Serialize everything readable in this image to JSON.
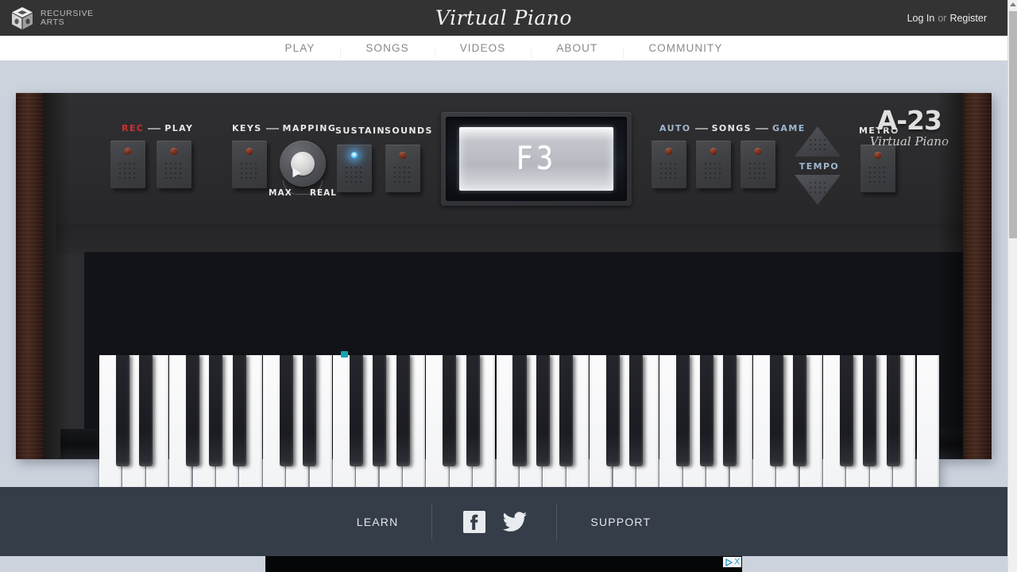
{
  "header": {
    "logo_icon": "cube-logo-icon",
    "brand_line1": "RECURSIVE",
    "brand_line2": "ARTS",
    "site_title": "Virtual Piano",
    "login_label": "Log In",
    "or_label": "or",
    "register_label": "Register"
  },
  "nav": {
    "items": [
      {
        "label": "PLAY"
      },
      {
        "label": "SONGS"
      },
      {
        "label": "VIDEOS"
      },
      {
        "label": "ABOUT"
      },
      {
        "label": "COMMUNITY"
      }
    ]
  },
  "piano": {
    "model_name": "A-23",
    "model_sub": "Virtual Piano",
    "display_value": "F3",
    "controls": {
      "rec_label": "REC",
      "play_label": "PLAY",
      "keys_label": "KEYS",
      "mapping_label": "MAPPING",
      "sustain_label": "SUSTAIN",
      "sounds_label": "SOUNDS",
      "knob_min_label": "MAX",
      "knob_max_label": "REAL",
      "auto_label": "AUTO",
      "songs_label": "SONGS",
      "game_label": "GAME",
      "tempo_label": "TEMPO",
      "metro_label": "METRO"
    },
    "leds": {
      "rec": "off",
      "play": "off",
      "keys": "off",
      "sustain": "on",
      "sounds": "off",
      "auto": "off",
      "songs": "off",
      "game": "off",
      "metro": "off"
    },
    "colors": {
      "rec_accent": "#d22f2f",
      "led_off": "#6d2a16",
      "led_on": "#3fa9e8",
      "label_blue": "#9fb6cf",
      "marker_teal": "#18a3b0",
      "wood": "#4a2b20",
      "cabinet": "#2d2d2f",
      "page_bg": "#ccd3dd",
      "footer_bg": "#343d48",
      "header_bg": "#333333"
    },
    "keyboard": {
      "white_key_count": 36,
      "octave_pattern": [
        "C",
        "D",
        "E",
        "F",
        "G",
        "A",
        "B"
      ],
      "black_key_offsets": [
        0,
        1,
        3,
        4,
        5
      ],
      "active_marker_key_index": 10
    }
  },
  "footer": {
    "learn_label": "LEARN",
    "support_label": "SUPPORT",
    "facebook_icon": "facebook-icon",
    "twitter_icon": "twitter-icon"
  },
  "ad": {
    "adchoices_icon": "adchoices-triangle-icon",
    "close_label": "X"
  }
}
